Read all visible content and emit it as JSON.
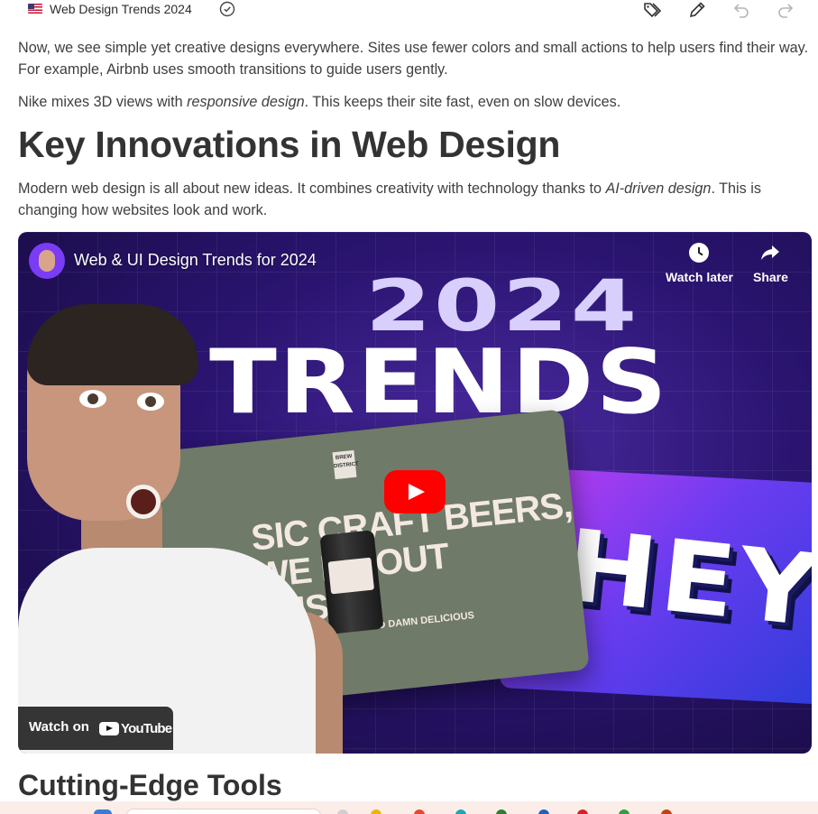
{
  "toolbar": {
    "doc_title": "Web Design Trends 2024",
    "icons": [
      "flag-us-icon",
      "check-circle-icon",
      "tags-icon",
      "pencil-icon",
      "undo-icon",
      "redo-icon"
    ]
  },
  "article": {
    "para1": "Now, we see simple yet creative designs everywhere. Sites use fewer colors and small actions to help users find their way. For example, Airbnb uses smooth transitions to guide users gently.",
    "para2_before": "Nike mixes 3D views with ",
    "para2_em": "responsive design",
    "para2_after": ". This keeps their site fast, even on slow devices.",
    "heading1": "Key Innovations in Web Design",
    "para3_before": "Modern web design is all about new ideas. It combines creativity with technology thanks to ",
    "para3_em": "AI-driven design",
    "para3_after": ". This is changing how websites look and work.",
    "heading2": "Cutting-Edge Tools"
  },
  "video": {
    "title": "Web & UI Design Trends for 2024",
    "watch_later": "Watch later",
    "share": "Share",
    "watch_on": "Watch on",
    "youtube": "YouTube",
    "thumb_line1": "2024",
    "thumb_line2": "TRENDS",
    "thumb_hey": "HEY",
    "thumb_beer_line1": "SIC CRAFT BEERS,",
    "thumb_beer_line2": "WE  ITHOUT",
    "thumb_beer_line3": "FUSS",
    "thumb_beer_sub": "HONEST AND DAMN DELICIOUS",
    "thumb_brew": "BREW DISTRICT"
  },
  "colors": {
    "youtube_red": "#ff0000",
    "text": "#3f3f3f",
    "heading": "#333333"
  }
}
